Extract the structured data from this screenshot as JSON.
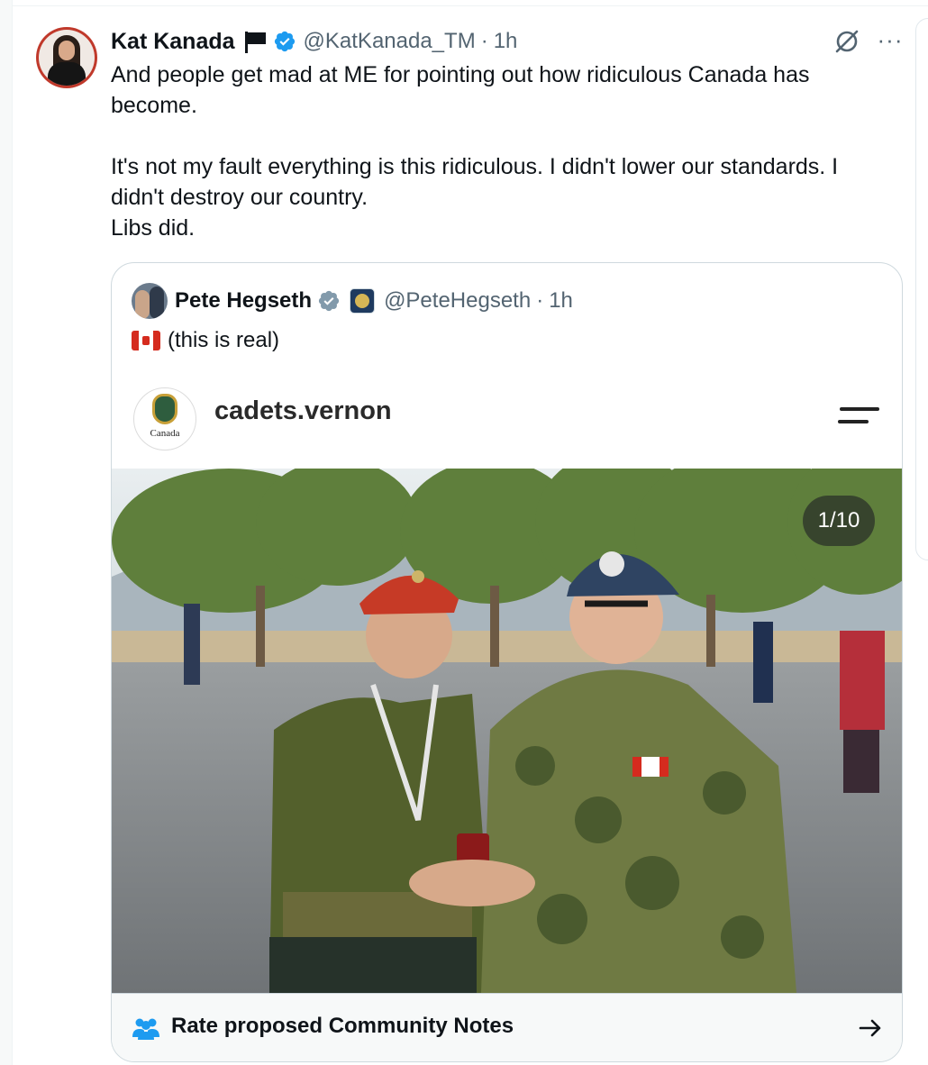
{
  "tweet": {
    "author": {
      "display_name": "Kat Kanada",
      "handle": "@KatKanada_TM",
      "time": "1h",
      "separator": "·"
    },
    "text_lines": [
      "And people get mad at ME for pointing out how ridiculous Canada has become.",
      "It's not my fault everything is this ridiculous. I didn't lower our standards. I didn't destroy our country.",
      "Libs did."
    ],
    "menu_glyph": "···"
  },
  "quote": {
    "author": {
      "display_name": "Pete Hegseth",
      "handle": "@PeteHegseth",
      "time": "1h",
      "separator": "·"
    },
    "text": "(this is real)",
    "media": {
      "account_name": "cadets.vernon",
      "logo_text": "Canada",
      "counter": "1/10"
    }
  },
  "community_notes": {
    "label": "Rate proposed Community Notes",
    "arrow": "→"
  },
  "colors": {
    "verified_blue": "#1d9bf0",
    "verified_grey": "#829aab",
    "secondary_text": "#536471",
    "avatar_ring": "#c0392b",
    "canada_red": "#d52b1e"
  },
  "icons": {
    "author_flag": "flag-icon",
    "verified": "verified-badge-icon",
    "grok": "grok-icon",
    "more": "more-icon",
    "canada_flag": "canada-flag-icon",
    "menu": "menu-icon",
    "community": "community-notes-icon",
    "arrow": "arrow-right-icon"
  }
}
